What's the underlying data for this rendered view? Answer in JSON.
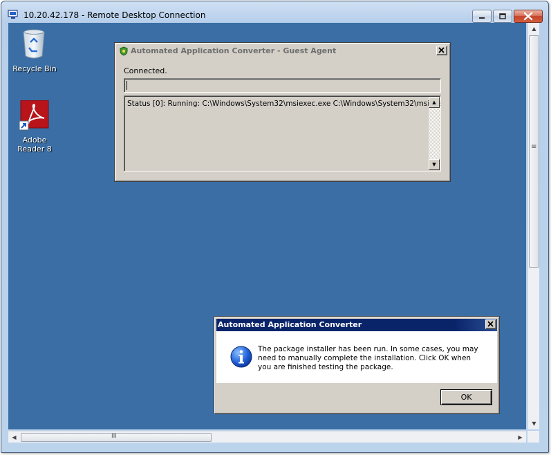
{
  "window": {
    "title": "10.20.42.178 - Remote Desktop Connection",
    "frame_color": "#b9d1ea",
    "desktop_color": "#3a6ea5"
  },
  "desktop_icons": [
    {
      "label": "Recycle Bin",
      "icon": "recycle-bin-icon"
    },
    {
      "label": "Adobe Reader 8",
      "icon": "adobe-reader-icon"
    }
  ],
  "agent_dialog": {
    "title": "Automated Application Converter - Guest Agent",
    "status": "Connected.",
    "log_text": "Status [0]: Running: C:\\Windows\\System32\\msiexec.exe C:\\Windows\\System32\\msiexec."
  },
  "message_dialog": {
    "title": "Automated Application Converter",
    "message": "The package installer has been run. In some cases, you may need to manually complete the installation. Click OK when you are finished testing the package.",
    "ok_label": "OK",
    "titlebar_color": "#0a246a"
  },
  "scrollbars": {
    "vertical_grip": "≡",
    "horizontal_grip": "III"
  }
}
